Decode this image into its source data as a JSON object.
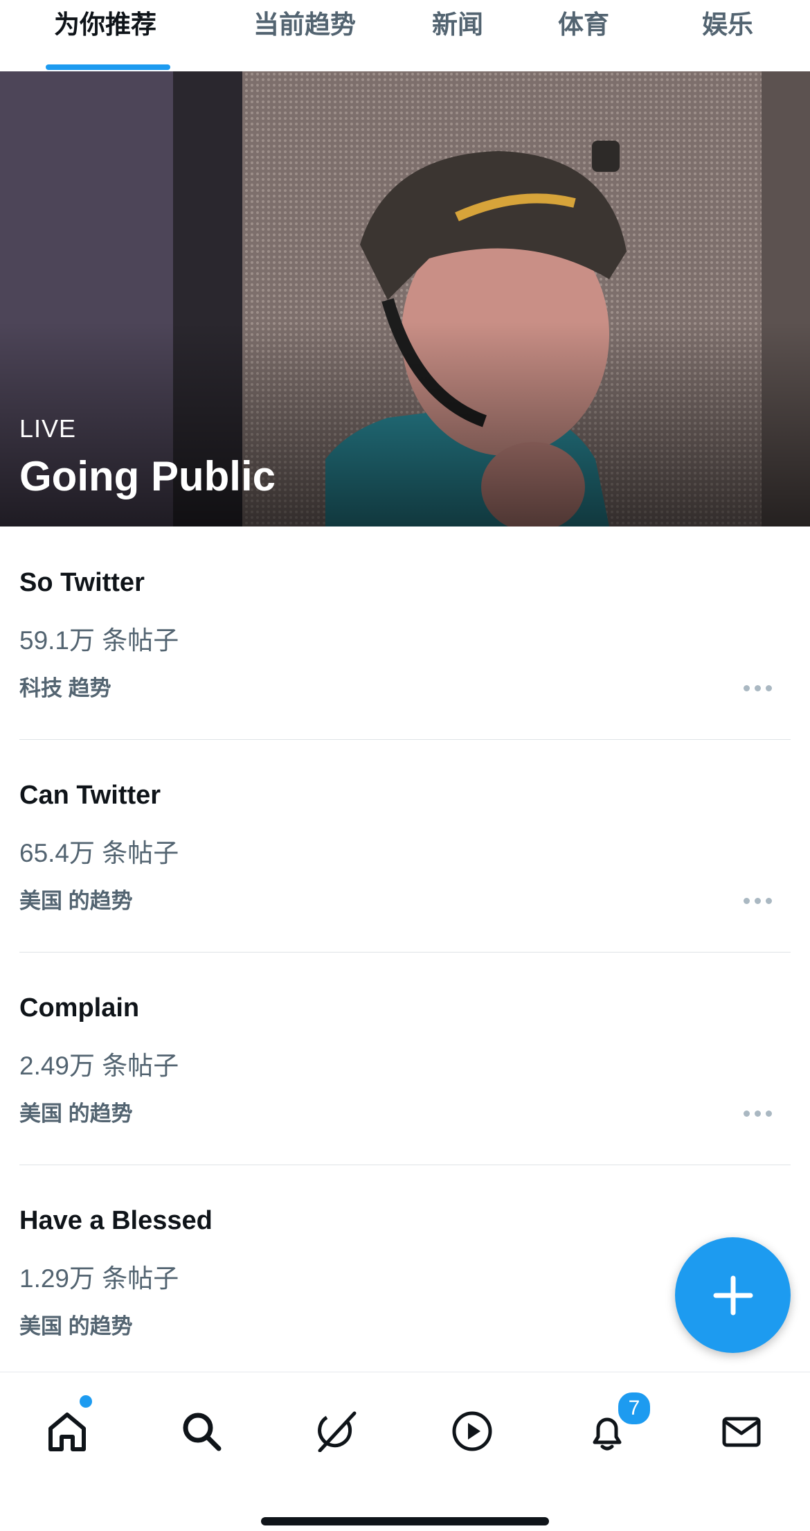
{
  "tabs": [
    {
      "label": "为你推荐",
      "active": true
    },
    {
      "label": "当前趋势",
      "active": false
    },
    {
      "label": "新闻",
      "active": false
    },
    {
      "label": "体育",
      "active": false
    },
    {
      "label": "娱乐",
      "active": false
    }
  ],
  "hero": {
    "badge": "LIVE",
    "title": "Going Public"
  },
  "trends": [
    {
      "name": "So Twitter",
      "count": "59.1万 条帖子",
      "category": "科技 趋势"
    },
    {
      "name": "Can Twitter",
      "count": "65.4万 条帖子",
      "category": "美国 的趋势"
    },
    {
      "name": "Complain",
      "count": "2.49万 条帖子",
      "category": "美国 的趋势"
    },
    {
      "name": "Have a Blessed",
      "count": "1.29万 条帖子",
      "category": "美国 的趋势"
    }
  ],
  "fab": {
    "icon": "plus-icon"
  },
  "bottom_nav": {
    "items": [
      "home-icon",
      "search-icon",
      "grok-icon",
      "video-play-icon",
      "bell-icon",
      "mail-icon"
    ],
    "notification_count": "7"
  },
  "colors": {
    "accent": "#1d9bf0",
    "text_primary": "#0f1419",
    "text_secondary": "#536471"
  }
}
